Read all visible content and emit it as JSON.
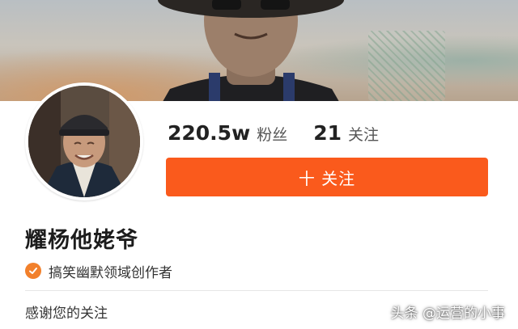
{
  "profile": {
    "followers_count": "220.5w",
    "followers_label": "粉丝",
    "following_count": "21",
    "following_label": "关注",
    "follow_button_label": "十 关注",
    "name": "耀杨他姥爷",
    "badge_text": "搞笑幽默领域创作者",
    "bio_line1": "感谢您的关注"
  },
  "watermark": {
    "text": "头条 @运营的小事"
  },
  "colors": {
    "accent": "#fa5a1c",
    "badge": "#f2802b"
  },
  "icons": {
    "badge": "check-circle-icon",
    "avatar": "avatar"
  }
}
